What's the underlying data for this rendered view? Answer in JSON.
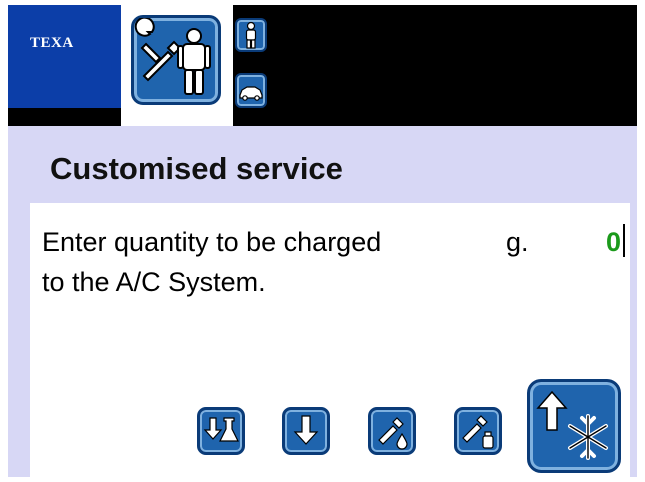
{
  "header": {
    "logo_text": "TEXA",
    "mode_icon": "tools-and-person-icon",
    "side_icons": [
      "person-icon",
      "car-icon"
    ]
  },
  "screen": {
    "title": "Customised service",
    "prompt_line1": "Enter quantity to be charged",
    "unit": "g.",
    "value": "0",
    "prompt_line2": "to the A/C System."
  },
  "toolbar": {
    "buttons": [
      "download-flask-icon",
      "arrow-down-icon",
      "oil-injector-icon",
      "dye-injector-icon",
      "arrow-up-snowflake-icon"
    ]
  },
  "colors": {
    "button_fill": "#1f64ad",
    "logo_blue": "#0c3ea8",
    "background": "#d7d7f5",
    "value_green": "#1b9a1b"
  }
}
